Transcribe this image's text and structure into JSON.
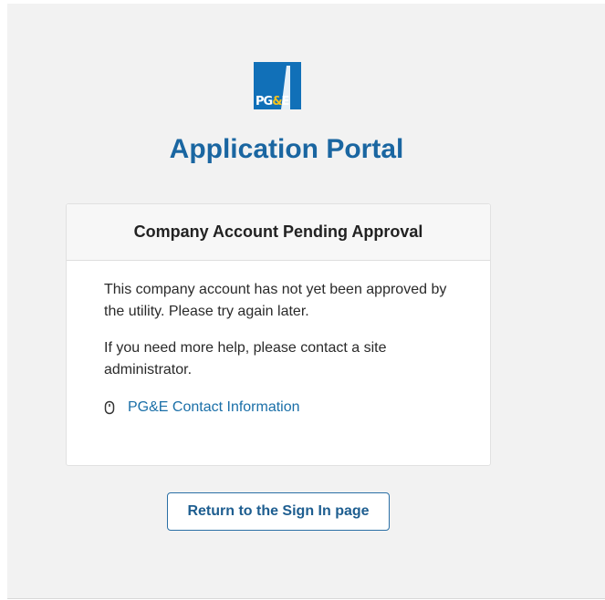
{
  "logo": {
    "alt": "PG&E logo",
    "text_left": "PG",
    "text_amp": "&",
    "text_right": "E",
    "bg_color": "#1170b8"
  },
  "app_title": "Application Portal",
  "card": {
    "title": "Company Account Pending Approval",
    "paragraph_1": "This company account has not yet been approved by the utility. Please try again later.",
    "paragraph_2": "If you need more help, please contact a site administrator.",
    "contact_link": "PG&E Contact Information",
    "contact_icon": "mouse-icon"
  },
  "return_button": "Return to the Sign In page",
  "colors": {
    "accent": "#1a66a1",
    "link": "#1a6fa8",
    "page_bg": "#f2f2f2"
  }
}
